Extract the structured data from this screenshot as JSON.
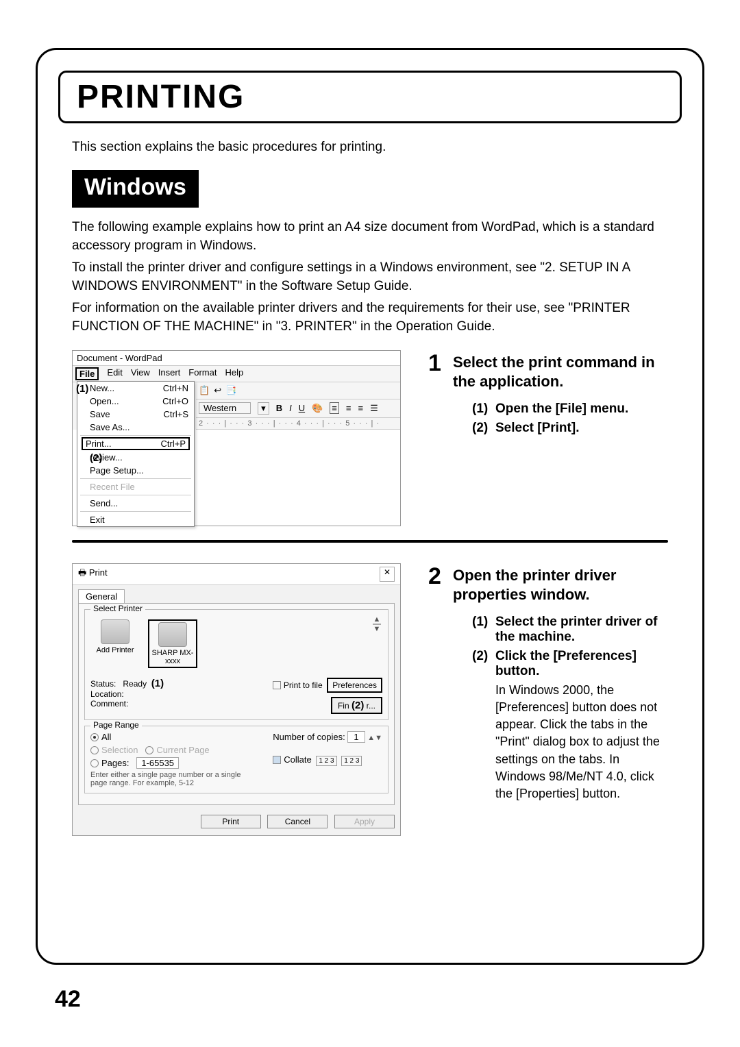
{
  "title": "PRINTING",
  "intro": "This section explains the basic procedures for printing.",
  "windows_label": "Windows",
  "para1": "The following example explains how to print an A4 size document from WordPad, which is a standard accessory program in Windows.",
  "para2": "To install the printer driver and configure settings in a Windows environment, see \"2. SETUP IN A WINDOWS ENVIRONMENT\" in the Software Setup Guide.",
  "para3": "For information on the available printer drivers and the requirements for their use, see \"PRINTER FUNCTION OF THE MACHINE\" in \"3. PRINTER\" in the Operation Guide.",
  "page_number": "42",
  "wordpad": {
    "title": "Document - WordPad",
    "menus": [
      "File",
      "Edit",
      "View",
      "Insert",
      "Format",
      "Help"
    ],
    "items": [
      {
        "label": "New...",
        "shortcut": "Ctrl+N"
      },
      {
        "label": "Open...",
        "shortcut": "Ctrl+O"
      },
      {
        "label": "Save",
        "shortcut": "Ctrl+S"
      },
      {
        "label": "Save As...",
        "shortcut": ""
      }
    ],
    "print": {
      "label": "Print...",
      "shortcut": "Ctrl+P"
    },
    "after_print": [
      {
        "label": "review..."
      },
      {
        "label": "Page Setup..."
      }
    ],
    "recent": "Recent File",
    "tail": [
      "Send...",
      "Exit"
    ],
    "font_box": "Western",
    "ruler": "2 · · · | · · · 3 · · · | · · · 4 · · · | · · · 5 · · · | ·",
    "toolbar_letters": [
      "B",
      "I",
      "U"
    ],
    "callout1": "(1)",
    "callout2": "(2)"
  },
  "step1": {
    "num": "1",
    "heading": "Select the print command in the application.",
    "sub1_n": "(1)",
    "sub1_t": "Open the [File] menu.",
    "sub2_n": "(2)",
    "sub2_t": "Select [Print]."
  },
  "printdlg": {
    "title": "Print",
    "tab": "General",
    "group1": "Select Printer",
    "printer1": "Add Printer",
    "printer2": "SHARP MX-xxxx",
    "status_lbl": "Status:",
    "status_val": "Ready",
    "location_lbl": "Location:",
    "comment_lbl": "Comment:",
    "print_to_file": "Print to file",
    "preferences": "Preferences",
    "find": "Fin",
    "group2": "Page Range",
    "all": "All",
    "selection": "Selection",
    "current": "Current Page",
    "pages": "Pages:",
    "pages_val": "1-65535",
    "pages_hint": "Enter either a single page number or a single page range. For example, 5-12",
    "copies_lbl": "Number of copies:",
    "copies_val": "1",
    "collate": "Collate",
    "collate_123": "1 2 3",
    "btn_print": "Print",
    "btn_cancel": "Cancel",
    "btn_apply": "Apply",
    "callout1": "(1)",
    "callout2": "(2)"
  },
  "step2": {
    "num": "2",
    "heading": "Open the printer driver properties window.",
    "sub1_n": "(1)",
    "sub1_t": "Select the printer driver of the machine.",
    "sub2_n": "(2)",
    "sub2_t": "Click the [Preferences] button.",
    "sub2_d": "In Windows 2000, the [Preferences] button does not appear. Click the tabs in the \"Print\" dialog box to adjust the settings on the tabs.\nIn Windows 98/Me/NT 4.0, click the [Properties] button."
  }
}
